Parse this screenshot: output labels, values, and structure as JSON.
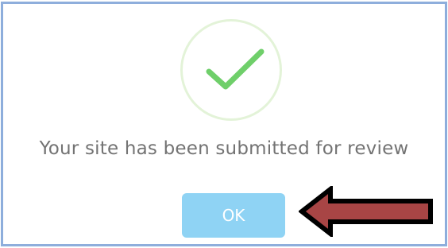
{
  "dialog": {
    "message": "Your site has been submitted for review",
    "ok_label": "OK"
  },
  "icons": {
    "success": "checkmark-icon",
    "pointer": "arrow-left-icon"
  },
  "colors": {
    "frame_border": "#8eaedc",
    "check_ring": "#e3f3d8",
    "checkmark": "#6fcf6a",
    "message_text": "#737373",
    "button_bg": "#8fd3f4",
    "button_text": "#ffffff",
    "arrow_fill": "#a84545",
    "arrow_outline": "#000000"
  }
}
